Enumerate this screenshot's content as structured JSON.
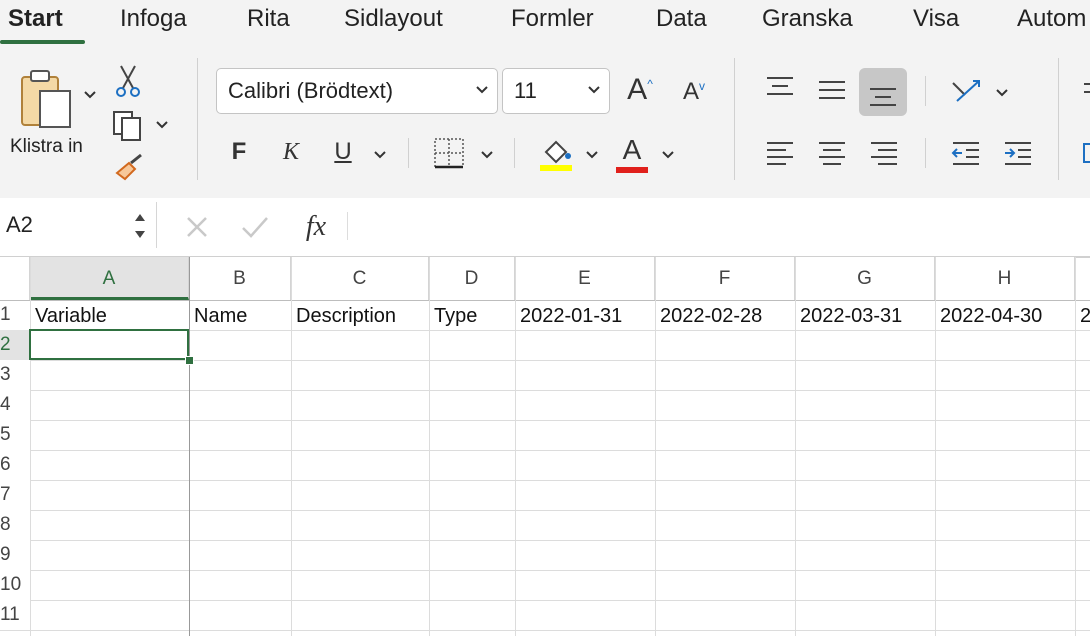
{
  "tabs": [
    {
      "label": "Start",
      "active": true
    },
    {
      "label": "Infoga"
    },
    {
      "label": "Rita"
    },
    {
      "label": "Sidlayout"
    },
    {
      "label": "Formler"
    },
    {
      "label": "Data"
    },
    {
      "label": "Granska"
    },
    {
      "label": "Visa"
    },
    {
      "label": "Autom"
    }
  ],
  "ribbon": {
    "paste_label": "Klistra in",
    "font_name": "Calibri (Brödtext)",
    "font_size": "11",
    "bold": "F",
    "italic": "K",
    "underline": "U",
    "font_color_letter": "A",
    "highlight_color": "#ffff00",
    "font_color": "#e0201b"
  },
  "formula_bar": {
    "cell_ref": "A2",
    "fx": "fx",
    "value": ""
  },
  "accent_color": "#2f7040",
  "columns": [
    "A",
    "B",
    "C",
    "D",
    "E",
    "F",
    "G",
    "H"
  ],
  "rows": [
    "1",
    "2",
    "3",
    "4",
    "5",
    "6",
    "7",
    "8",
    "9",
    "10",
    "11"
  ],
  "row1": [
    "Variable",
    "Name",
    "Description",
    "Type",
    "2022-01-31",
    "2022-02-28",
    "2022-03-31",
    "2022-04-30",
    "2"
  ],
  "selected_cell": "A2"
}
